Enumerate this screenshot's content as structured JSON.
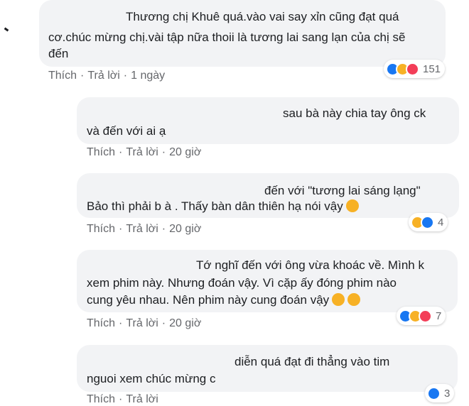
{
  "comments": [
    {
      "lines": [
        "Thương chị Khuê quá.vào vai say xỉn cũng đạt quá",
        "cơ.chúc mừng chị.vài tập nữa thoii là tương lai sang lạn của chị sẽ",
        "đến"
      ],
      "actions": {
        "like": "Thích",
        "reply": "Trả lời",
        "time": "1 ngày"
      },
      "reactions": {
        "icons": [
          "like-icon",
          "haha-icon",
          "love-icon"
        ],
        "count": "151"
      }
    },
    {
      "lines": [
        "sau bà này chia tay ông ck",
        "và đến với ai ạ"
      ],
      "actions": {
        "like": "Thích",
        "reply": "Trả lời",
        "time": "20 giờ"
      }
    },
    {
      "lines": [
        "đến với \"tương lai sáng lạng\"",
        "Bảo thì phải b à . Thấy bàn dân thiên hạ nói vậy"
      ],
      "actions": {
        "like": "Thích",
        "reply": "Trả lời",
        "time": "20 giờ"
      },
      "reactions": {
        "icons": [
          "haha-icon",
          "like-icon"
        ],
        "count": "4"
      }
    },
    {
      "lines": [
        "Tớ nghĩ đến với ông vừa khoác về. Mình k",
        "xem phim này. Nhưng đoán vậy. Vì cặp ấy đóng phim nào",
        "cung yêu nhau. Nên phim này cung đoán vậy"
      ],
      "actions": {
        "like": "Thích",
        "reply": "Trả lời",
        "time": "20 giờ"
      },
      "reactions": {
        "icons": [
          "like-icon",
          "haha-icon",
          "love-icon"
        ],
        "count": "7"
      }
    },
    {
      "lines": [
        "diễn quá đạt đi thẳng vào tim",
        "nguoi xem chúc mừng c"
      ],
      "actions": {
        "like": "Thích",
        "reply": "Trả lời",
        "time": ""
      },
      "reactions": {
        "icons": [
          "like-icon"
        ],
        "count": "3"
      }
    }
  ],
  "colors": {
    "bubble": "#f2f3f5",
    "text": "#1c1e21",
    "meta": "#65676b",
    "like": "#1877f2",
    "haha": "#f7b125",
    "love": "#f33e58"
  }
}
